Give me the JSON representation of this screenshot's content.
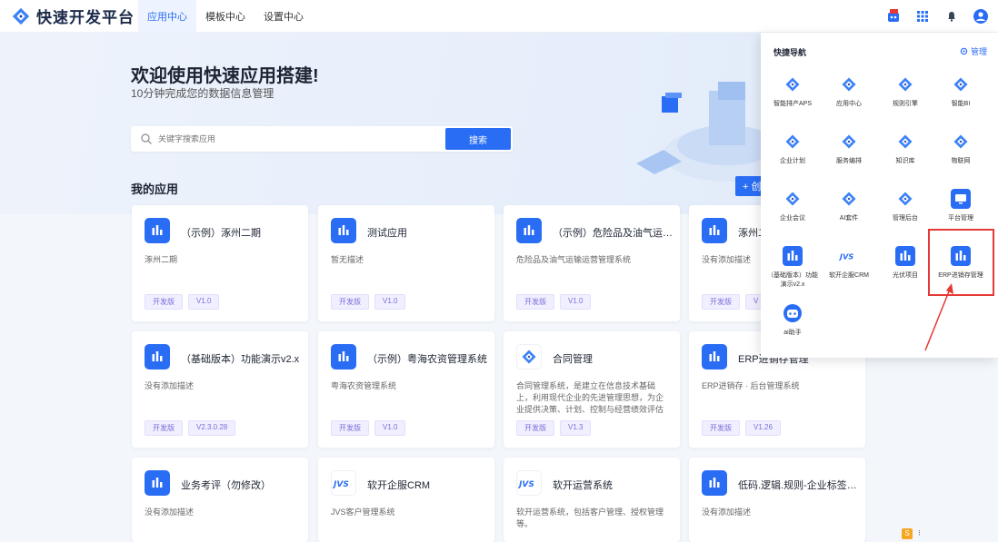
{
  "app": {
    "title": "快速开发平台"
  },
  "nav": [
    {
      "label": "应用中心",
      "active": true
    },
    {
      "label": "模板中心",
      "active": false
    },
    {
      "label": "设置中心",
      "active": false
    }
  ],
  "hero": {
    "title": "欢迎使用快速应用搭建!",
    "subtitle": "10分钟完成您的数据信息管理",
    "search_placeholder": "关键字搜索应用",
    "search_button": "搜索"
  },
  "my_apps": {
    "title": "我的应用",
    "create_label": "+ 创",
    "cards": [
      {
        "title": "（示例）涿州二期",
        "desc": "涿州二期",
        "tags": [
          "开发版",
          "V1.0"
        ],
        "icon": "chart-icon"
      },
      {
        "title": "测试应用",
        "desc": "暂无描述",
        "tags": [
          "开发版",
          "V1.0"
        ],
        "icon": "chart-icon"
      },
      {
        "title": "（示例）危险品及油气运输...",
        "desc": "危险品及油气运输运营管理系统",
        "tags": [
          "开发版",
          "V1.0"
        ],
        "icon": "chart-icon"
      },
      {
        "title": "涿州二",
        "desc": "没有添加描述",
        "tags": [
          "开发版",
          "V"
        ],
        "icon": "chart-icon"
      },
      {
        "title": "（基础版本）功能演示v2.x",
        "desc": "没有添加描述",
        "tags": [
          "开发版",
          "V2.3.0.28"
        ],
        "icon": "chart-icon"
      },
      {
        "title": "（示例）粤海农资管理系统",
        "desc": "粤海农资管理系统",
        "tags": [
          "开发版",
          "V1.0"
        ],
        "icon": "chart-icon"
      },
      {
        "title": "合同管理",
        "desc": "合同管理系统，是建立在信息技术基础上，利用现代企业的先进管理思想，为企业提供决策、计划、控制与经营绩效评估的全方...",
        "tags": [
          "开发版",
          "V1.3"
        ],
        "icon": "logo-icon"
      },
      {
        "title": "ERP进销存管理",
        "desc": "ERP进销存 · 后台管理系统",
        "tags": [
          "开发版",
          "V1.26"
        ],
        "icon": "chart-icon"
      },
      {
        "title": "业务考评（勿修改）",
        "desc": "没有添加描述",
        "tags": [],
        "icon": "chart-icon"
      },
      {
        "title": "软开企服CRM",
        "desc": "JVS客户管理系统",
        "tags": [],
        "icon": "jvs-icon"
      },
      {
        "title": "软开运营系统",
        "desc": "软开运营系统，包括客户管理、授权管理等。",
        "tags": [],
        "icon": "jvs-icon"
      },
      {
        "title": "低码.逻辑.规则-企业标签管理",
        "desc": "没有添加描述",
        "tags": [],
        "icon": "chart-icon"
      }
    ]
  },
  "quick_nav": {
    "title": "快捷导航",
    "manage": "管理",
    "items": [
      {
        "label": "智能排产APS",
        "icon": "logo-icon"
      },
      {
        "label": "应用中心",
        "icon": "logo-icon"
      },
      {
        "label": "规则引擎",
        "icon": "logo-icon"
      },
      {
        "label": "智能BI",
        "icon": "logo-icon"
      },
      {
        "label": "企业计划",
        "icon": "logo-icon"
      },
      {
        "label": "服务编排",
        "icon": "logo-icon"
      },
      {
        "label": "知识库",
        "icon": "logo-icon"
      },
      {
        "label": "物联网",
        "icon": "logo-icon"
      },
      {
        "label": "企业会议",
        "icon": "logo-icon"
      },
      {
        "label": "AI套件",
        "icon": "logo-icon"
      },
      {
        "label": "管理后台",
        "icon": "logo-icon"
      },
      {
        "label": "平台管理",
        "icon": "monitor-icon"
      },
      {
        "label": "（基础版本）功能演示v2.x",
        "icon": "chart-icon"
      },
      {
        "label": "软开企服CRM",
        "icon": "jvs-icon"
      },
      {
        "label": "光伏项目",
        "icon": "chart-icon"
      },
      {
        "label": "ERP进销存管理",
        "icon": "chart-icon"
      },
      {
        "label": "ai助手",
        "icon": "robot-icon"
      }
    ]
  },
  "colors": {
    "accent": "#2a6df5",
    "highlight": "#e53935",
    "tag_text": "#7a6fd8"
  }
}
